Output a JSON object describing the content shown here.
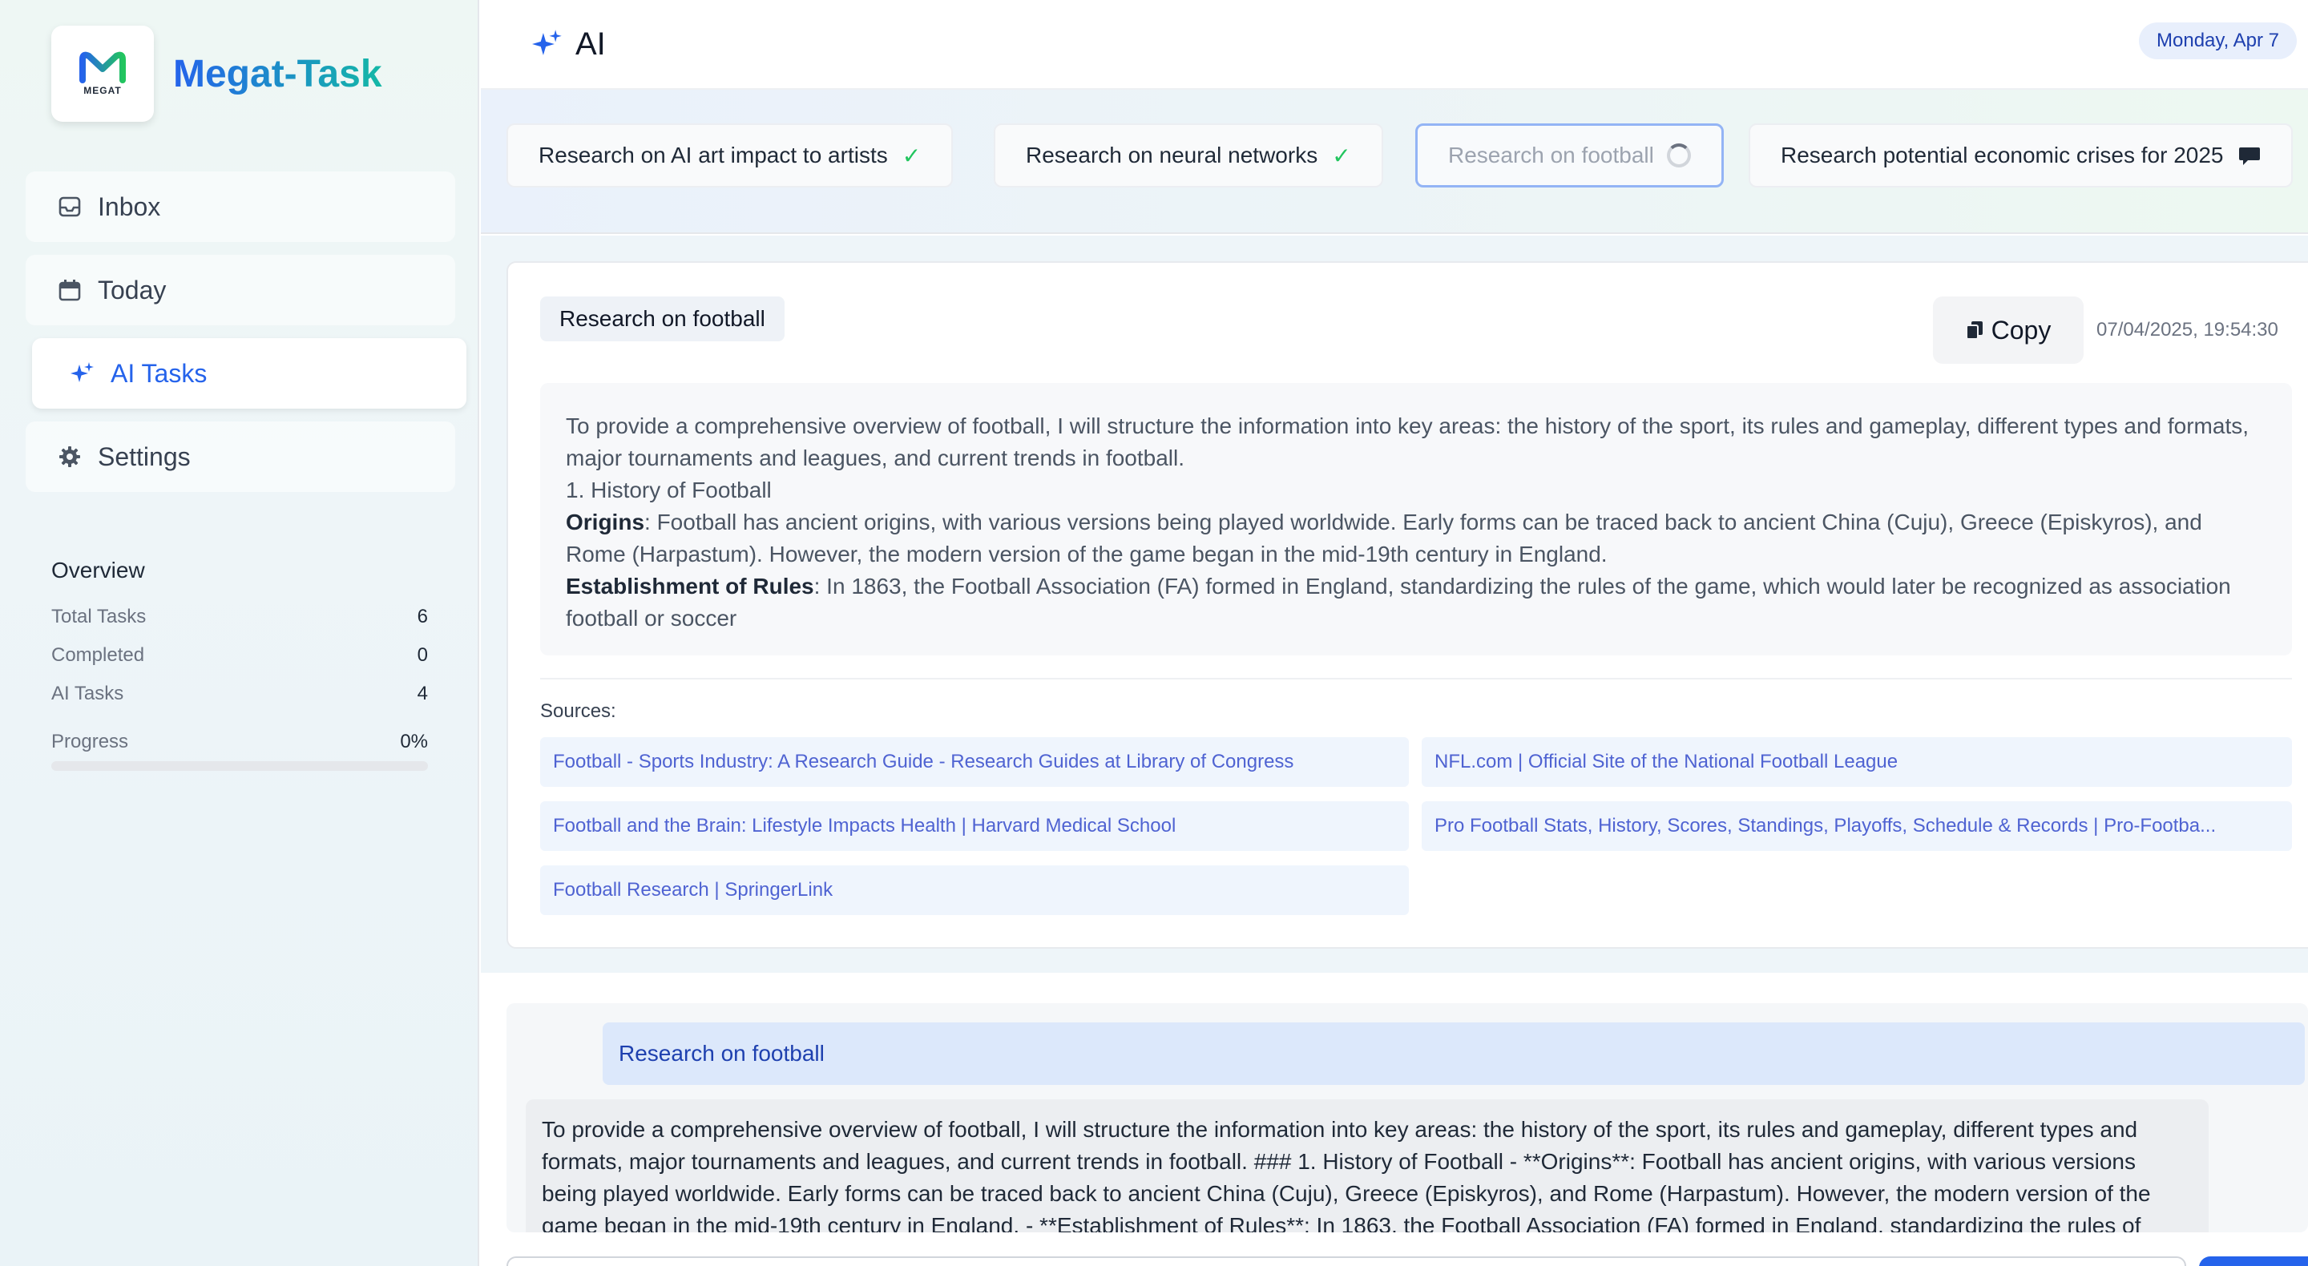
{
  "app": {
    "brand_name": "Megat-Task",
    "logo_text": "MEGAT",
    "brand_gradient": [
      "#2563eb",
      "#14b8a6"
    ]
  },
  "sidebar": {
    "items": [
      {
        "label": "Inbox",
        "icon": "inbox-icon"
      },
      {
        "label": "Today",
        "icon": "calendar-icon"
      },
      {
        "label": "AI Tasks",
        "icon": "sparkles-icon",
        "active": true
      },
      {
        "label": "Settings",
        "icon": "gear-icon"
      }
    ]
  },
  "overview": {
    "title": "Overview",
    "total_label": "Total Tasks",
    "total_value": "6",
    "completed_label": "Completed",
    "completed_value": "0",
    "ai_label": "AI Tasks",
    "ai_value": "4",
    "progress_label": "Progress",
    "progress_value": "0%",
    "progress_fraction": 0
  },
  "header": {
    "title": "AI",
    "date": "Monday, Apr 7"
  },
  "tasks": [
    {
      "label": "Research on AI art impact to artists",
      "status": "done"
    },
    {
      "label": "Research on neural networks",
      "status": "done"
    },
    {
      "label": "Research on football",
      "status": "loading"
    },
    {
      "label": "Research potential economic crises for 2025",
      "status": "comment"
    }
  ],
  "result": {
    "tag": "Research on football",
    "copy_label": "Copy",
    "timestamp": "07/04/2025, 19:54:30",
    "intro": "To provide a comprehensive overview of football, I will structure the information into key areas: the history of the sport, its rules and gameplay, different types and formats, major tournaments and leagues, and current trends in football.",
    "heading": "1. History of Football",
    "origins_label": "Origins",
    "origins_text": ": Football has ancient origins, with various versions being played worldwide. Early forms can be traced back to ancient China (Cuju), Greece (Episkyros), and Rome (Harpastum). However, the modern version of the game began in the mid-19th century in England.",
    "rules_label": "Establishment of Rules",
    "rules_text": ": In 1863, the Football Association (FA) formed in England, standardizing the rules of the game, which would later be recognized as association football or soccer",
    "sources_label": "Sources:",
    "sources": [
      "Football - Sports Industry: A Research Guide - Research Guides at Library of Congress",
      "NFL.com | Official Site of the National Football League",
      "Football and the Brain: Lifestyle Impacts Health | Harvard Medical School",
      "Pro Football Stats, History, Scores, Standings, Playoffs, Schedule & Records | Pro-Footba...",
      "Football Research | SpringerLink"
    ]
  },
  "chat": {
    "user_message": "Research on football",
    "ai_message": "To provide a comprehensive overview of football, I will structure the information into key areas: the history of the sport, its rules and gameplay, different types and formats, major tournaments and leagues, and current trends in football. ### 1. History of Football - **Origins**: Football has ancient origins, with various versions being played worldwide. Early forms can be traced back to ancient China (Cuju), Greece (Episkyros), and Rome (Harpastum). However, the modern version of the game began in the mid-19th century in England. - **Establishment of Rules**: In 1863, the Football Association (FA) formed in England, standardizing the rules of"
  }
}
